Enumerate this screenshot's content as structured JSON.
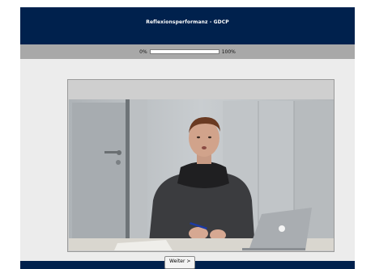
{
  "header": {
    "title": "Reflexionsperformanz - GDCP"
  },
  "progress": {
    "label_start": "0%",
    "label_end": "100%",
    "value": 0.0
  },
  "video": {
    "icon": "video-player"
  },
  "footer": {
    "next_label": "Weiter >"
  },
  "colors": {
    "header_bg": "#00214d",
    "progress_bg": "#a8a8a8",
    "page_bg": "#ececec"
  }
}
